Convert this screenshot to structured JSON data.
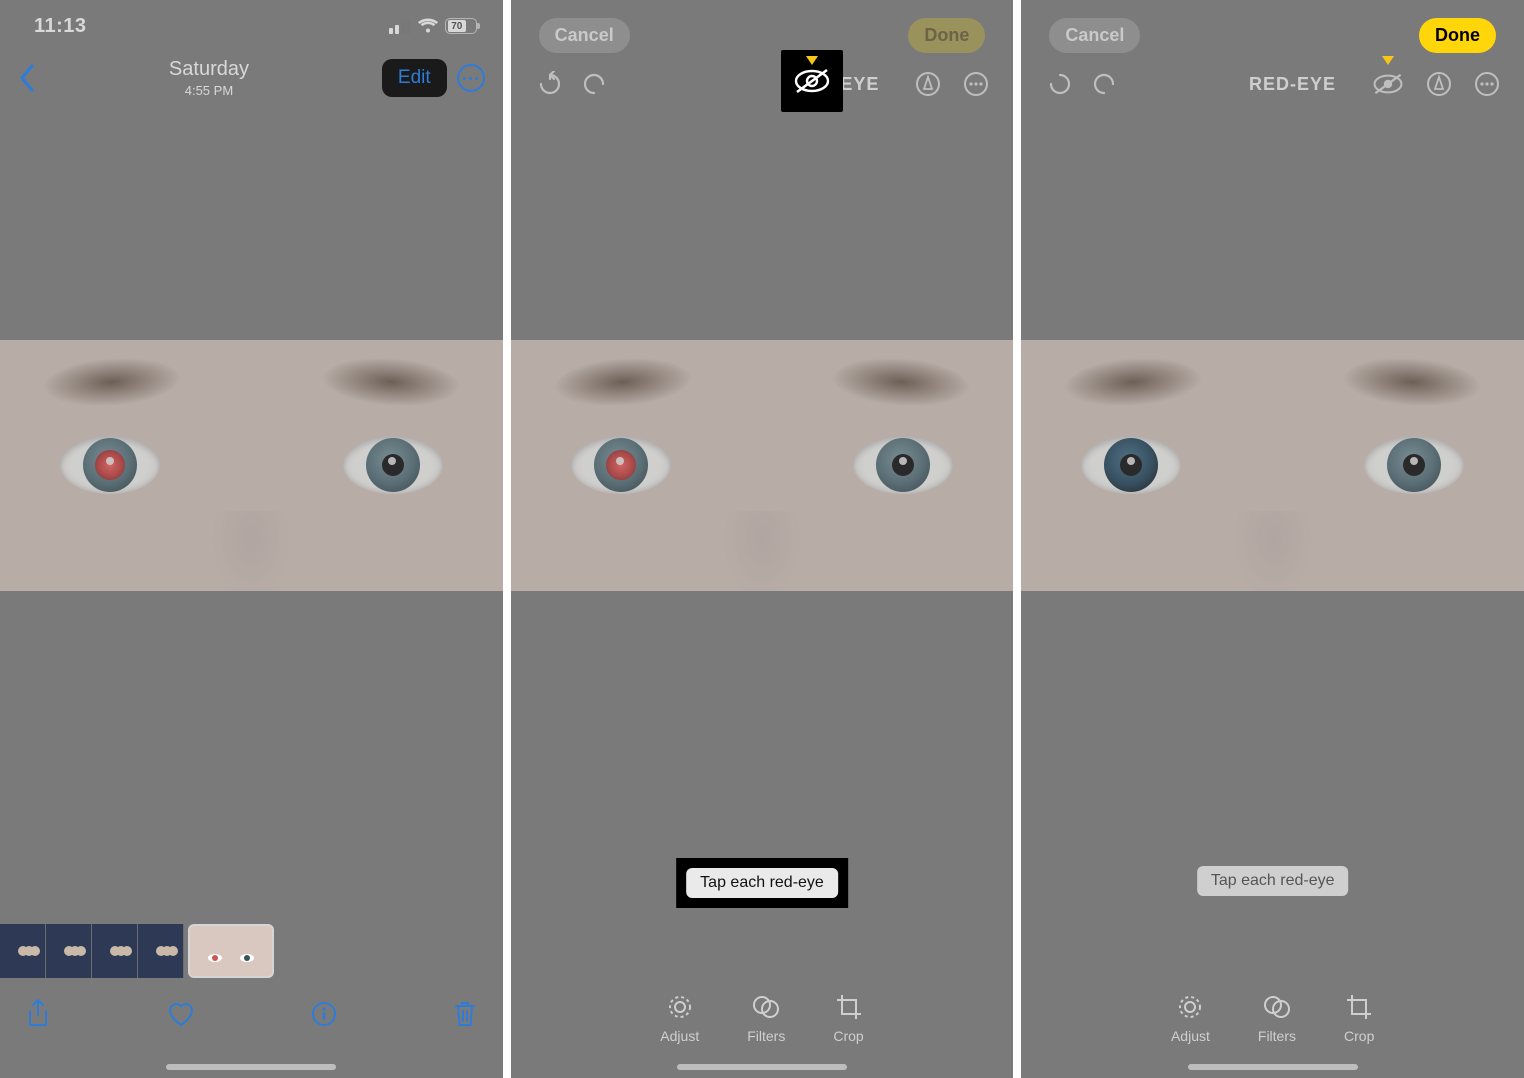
{
  "screen1": {
    "time": "11:13",
    "battery_pct": "70",
    "nav_title": "Saturday",
    "nav_subtitle": "4:55 PM",
    "edit_label": "Edit"
  },
  "screen2": {
    "cancel_label": "Cancel",
    "done_label": "Done",
    "tool_label": "RED-EYE",
    "hint": "Tap each red-eye",
    "tabs": {
      "adjust": "Adjust",
      "filters": "Filters",
      "crop": "Crop"
    }
  },
  "screen3": {
    "cancel_label": "Cancel",
    "done_label": "Done",
    "tool_label": "RED-EYE",
    "hint": "Tap each red-eye",
    "tabs": {
      "adjust": "Adjust",
      "filters": "Filters",
      "crop": "Crop"
    }
  }
}
